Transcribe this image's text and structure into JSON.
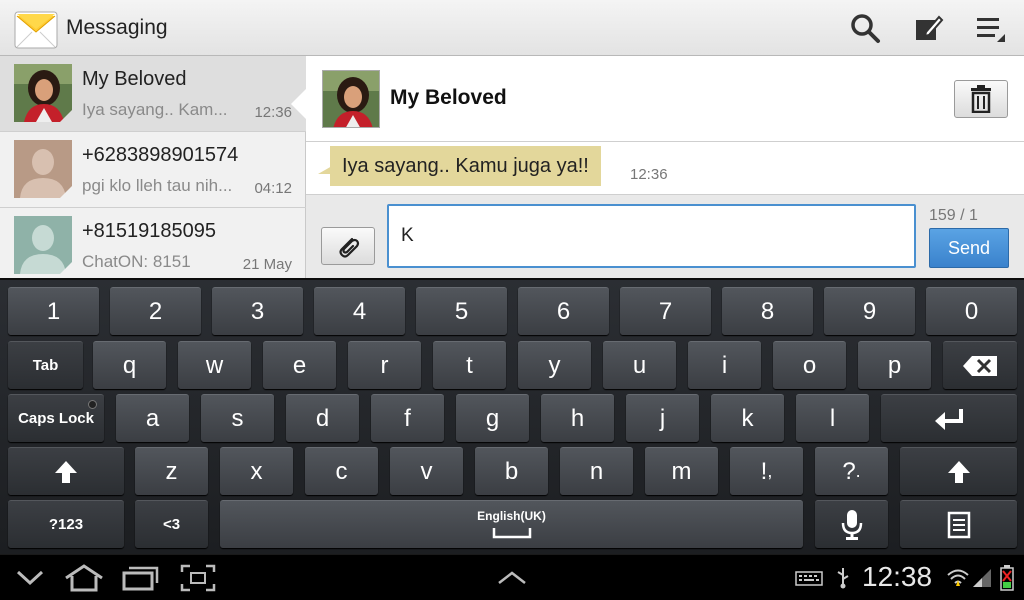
{
  "app": {
    "title": "Messaging",
    "icon": "envelope-icon"
  },
  "action_bar": {
    "search_icon": "search-icon",
    "compose_icon": "compose-icon",
    "menu_icon": "menu-icon"
  },
  "threads": [
    {
      "name": "My Beloved",
      "preview": "Iya sayang.. Kam...",
      "time": "12:36",
      "avatar": "photo-avatar"
    },
    {
      "name": "+6283898901574",
      "preview": "pgi klo lleh tau nih...",
      "time": "04:12",
      "avatar": "default-avatar"
    },
    {
      "name": "+81519185095",
      "preview": "ChatON: 8151",
      "time": "21 May",
      "avatar": "default-avatar-teal"
    }
  ],
  "conversation": {
    "contact_name": "My Beloved",
    "delete_icon": "trash-icon",
    "messages": [
      {
        "text": "Iya sayang.. Kamu juga ya!!",
        "time": "12:36"
      }
    ],
    "composer": {
      "input_value": "K",
      "counter": "159 / 1",
      "send_label": "Send",
      "attach_icon": "paperclip-icon"
    }
  },
  "keyboard": {
    "row1": [
      "1",
      "2",
      "3",
      "4",
      "5",
      "6",
      "7",
      "8",
      "9",
      "0"
    ],
    "row2_tab": "Tab",
    "row2": [
      "q",
      "w",
      "e",
      "r",
      "t",
      "y",
      "u",
      "i",
      "o",
      "p"
    ],
    "row3_caps": "Caps Lock",
    "row3": [
      "a",
      "s",
      "d",
      "f",
      "g",
      "h",
      "j",
      "k",
      "l"
    ],
    "row4": [
      "z",
      "x",
      "c",
      "v",
      "b",
      "n",
      "m"
    ],
    "row4_punct1": "!",
    "row4_punct1_sub": ",",
    "row4_punct2": "?",
    "row4_punct2_sub": ".",
    "row5_sym": "?123",
    "row5_emoticon": "<3",
    "space_language": "English(UK)"
  },
  "system_bar": {
    "clock": "12:38"
  },
  "colors": {
    "accent": "#3a82cc",
    "bubble": "#e3d79b",
    "keyboard_bg": "#1c1e21"
  }
}
